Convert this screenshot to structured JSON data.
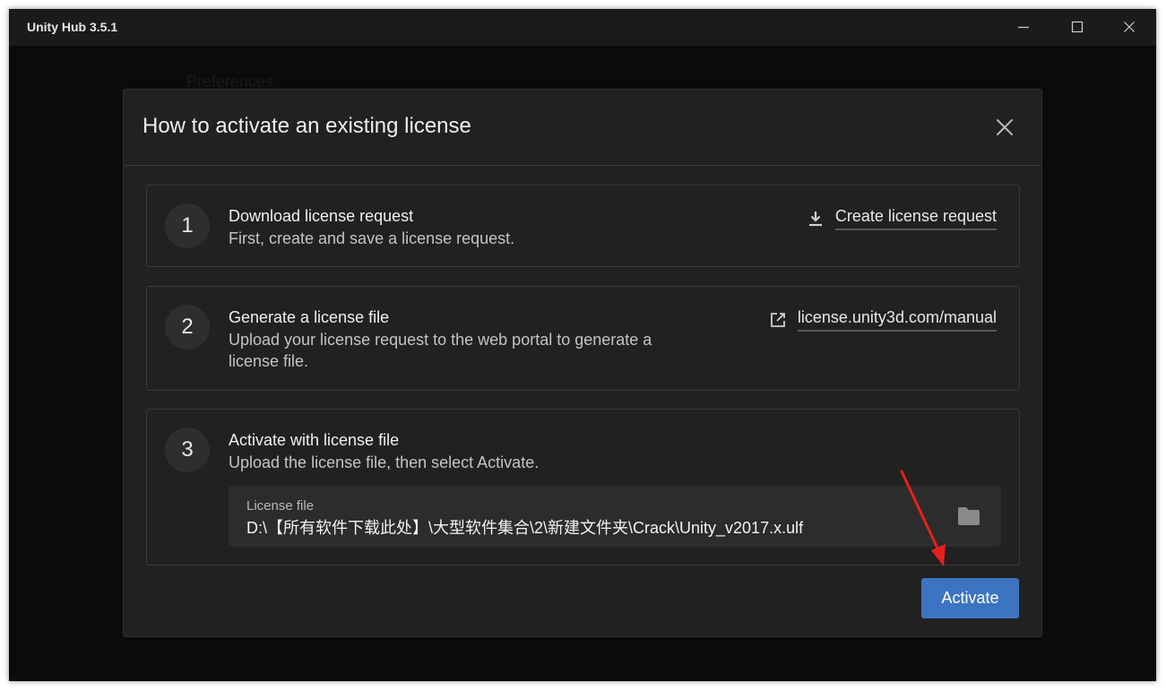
{
  "window": {
    "title": "Unity Hub 3.5.1"
  },
  "background": {
    "page_title": "Preferences"
  },
  "modal": {
    "title": "How to activate an existing license",
    "steps": [
      {
        "number": "1",
        "title": "Download license request",
        "description": "First, create and save a license request.",
        "action_label": "Create license request",
        "action_icon": "download-icon"
      },
      {
        "number": "2",
        "title": "Generate a license file",
        "description": "Upload your license request to the web portal to generate a license file.",
        "action_label": "license.unity3d.com/manual",
        "action_icon": "external-link-icon"
      },
      {
        "number": "3",
        "title": "Activate with license file",
        "description": "Upload the license file, then select Activate.",
        "field_label": "License file",
        "field_value": "D:\\【所有软件下载此处】\\大型软件集合\\2\\新建文件夹\\Crack\\Unity_v2017.x.ulf",
        "field_icon": "folder-icon"
      }
    ],
    "activate_label": "Activate"
  },
  "colors": {
    "accent": "#3d74c2",
    "annotation_arrow": "#e8201c"
  }
}
